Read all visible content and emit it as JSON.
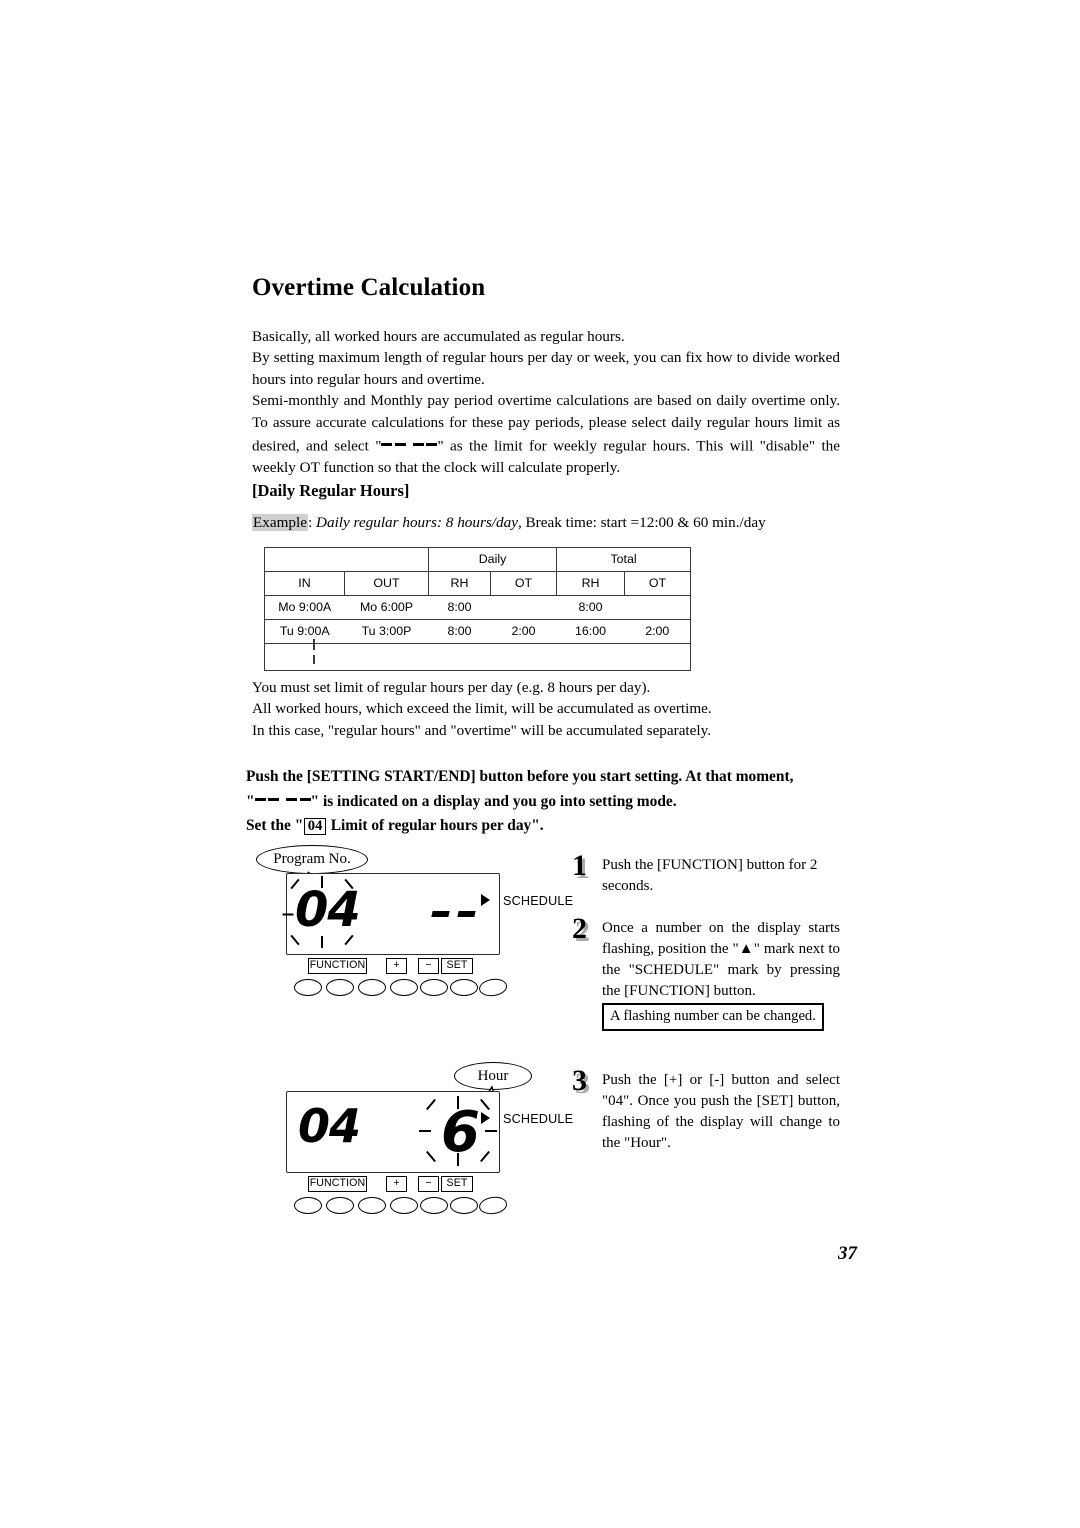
{
  "document": {
    "title": "Overtime Calculation",
    "page_number": "37"
  },
  "intro": {
    "line1": "Basically, all worked hours are accumulated as regular hours.",
    "line2": "By setting maximum length of regular hours per day or week, you can fix how to divide worked hours into regular hours and overtime.",
    "line3_a": "Semi-monthly and Monthly pay period overtime calculations are based on daily overtime only.  To assure accurate calculations for these pay periods, please select daily regular hours limit as desired, and select \"",
    "line3_b": "\" as the limit for weekly regular hours. This will \"disable\" the weekly OT function so that the clock will calculate properly."
  },
  "section": {
    "heading": "[Daily Regular Hours]",
    "example_label": "Example",
    "example_colon": ": ",
    "example_italic": "Daily regular hours: 8 hours/day",
    "example_rest": ", Break time: start =12:00 & 60 min./day"
  },
  "table": {
    "group_headers": [
      "",
      "Daily",
      "Total"
    ],
    "column_headers": [
      "IN",
      "OUT",
      "RH",
      "OT",
      "RH",
      "OT"
    ],
    "rows": [
      [
        "Mo 9:00A",
        "Mo 6:00P",
        "8:00",
        "",
        "8:00",
        ""
      ],
      [
        "Tu  9:00A",
        "Tu  3:00P",
        "8:00",
        "2:00",
        "16:00",
        "2:00"
      ],
      [
        "",
        "",
        "",
        "",
        "",
        ""
      ]
    ]
  },
  "after_table": {
    "line1": "You must set limit of regular hours per day (e.g. 8 hours per day).",
    "line2": "All worked hours, which exceed the limit, will be accumulated as overtime.",
    "line3": "In this case, \"regular hours\" and \"overtime\" will be accumulated separately."
  },
  "bold_instructions": {
    "line1": "Push the [SETTING START/END] button before you start setting.  At that moment,",
    "line2_a": "\"",
    "line2_b": "\" is indicated on a display and you go into setting mode.",
    "line3_a": "Set the \"",
    "line3_box": "04",
    "line3_b": "Limit of regular hours per day\"."
  },
  "figures": {
    "figure1": {
      "callout_label": "Program No.",
      "digits": "04",
      "dash_count": 2,
      "schedule_label": "SCHEDULE",
      "buttons": {
        "function": "FUNCTION",
        "plus": "+",
        "minus": "−",
        "set": "SET",
        "oval_count": 7
      }
    },
    "figure2": {
      "callout_label": "Hour",
      "digits_left": "04",
      "digits_right": "6",
      "schedule_label": "SCHEDULE",
      "buttons": {
        "function": "FUNCTION",
        "plus": "+",
        "minus": "−",
        "set": "SET",
        "oval_count": 7
      }
    }
  },
  "steps": [
    {
      "number": "1",
      "text": "Push the [FUNCTION] button for 2 seconds."
    },
    {
      "number": "2",
      "text": "Once a number on the display starts flashing, position the \"▲\" mark next to the \"SCHEDULE\" mark by pressing the [FUNCTION] button."
    },
    {
      "number": "3",
      "text": "Push the [+] or [-] button and select \"04\". Once you push the [SET] button, flashing of the display will change to the \"Hour\"."
    }
  ],
  "note": {
    "text": "A flashing number can be changed."
  }
}
